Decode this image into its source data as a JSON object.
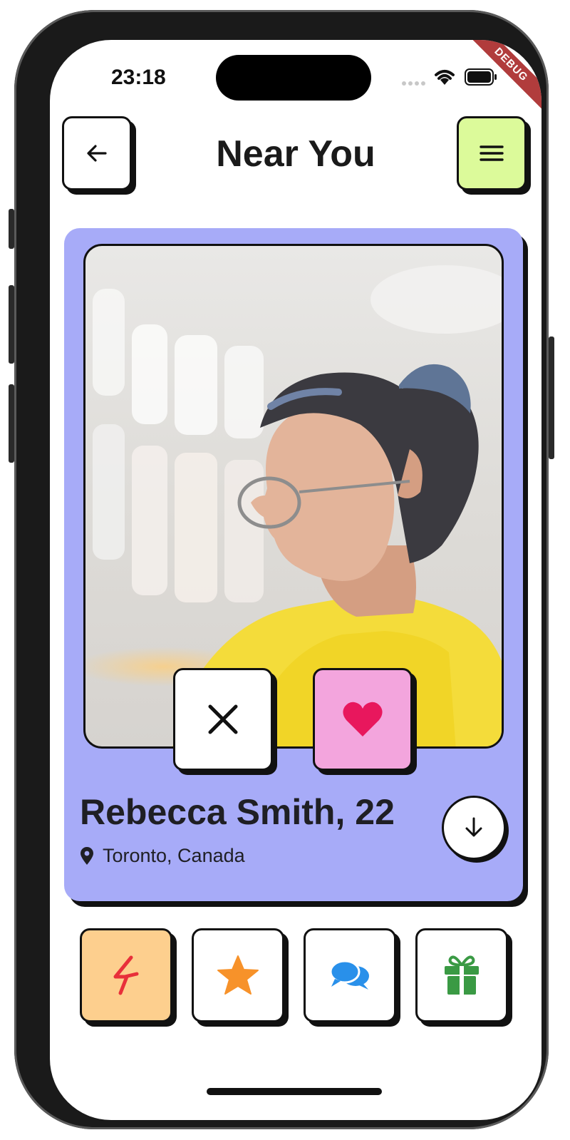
{
  "status_bar": {
    "time": "23:18"
  },
  "debug_banner": "DEBUG",
  "header": {
    "title": "Near You",
    "back_icon": "arrow-left-icon",
    "menu_icon": "hamburger-menu-icon"
  },
  "profile": {
    "name_age": "Rebecca Smith, 22",
    "location": "Toronto, Canada",
    "location_icon": "location-pin-icon",
    "expand_icon": "arrow-down-icon"
  },
  "actions": {
    "dislike_icon": "close-icon",
    "like_icon": "heart-icon"
  },
  "toolbar": [
    {
      "icon": "lightning-bolt-icon"
    },
    {
      "icon": "star-icon"
    },
    {
      "icon": "chat-bubbles-icon"
    },
    {
      "icon": "gift-icon"
    }
  ],
  "colors": {
    "card_background": "#a7abf8",
    "menu_button": "#dcfa9a",
    "like_button": "#f3a5dd",
    "heart": "#e8175d",
    "boost_button": "#fdcf8e",
    "bolt": "#e8303a",
    "star": "#f7922a",
    "chat": "#2990ea",
    "gift": "#3a9a44",
    "debug_banner": "#b13c3c"
  }
}
